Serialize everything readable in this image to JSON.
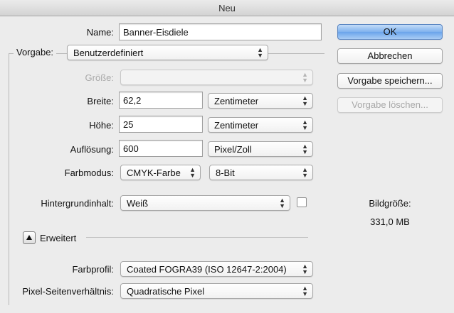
{
  "window": {
    "title": "Neu"
  },
  "form": {
    "name_label": "Name:",
    "name_value": "Banner-Eisdiele",
    "vorgabe_label": "Vorgabe:",
    "vorgabe_value": "Benutzerdefiniert",
    "groesse_label": "Größe:",
    "groesse_value": "",
    "breite_label": "Breite:",
    "breite_value": "62,2",
    "breite_unit": "Zentimeter",
    "hoehe_label": "Höhe:",
    "hoehe_value": "25",
    "hoehe_unit": "Zentimeter",
    "aufloesung_label": "Auflösung:",
    "aufloesung_value": "600",
    "aufloesung_unit": "Pixel/Zoll",
    "farbmodus_label": "Farbmodus:",
    "farbmodus_value": "CMYK-Farbe",
    "farbtiefe_value": "8-Bit",
    "hintergrund_label": "Hintergrundinhalt:",
    "hintergrund_value": "Weiß",
    "erweitert_label": "Erweitert",
    "farbprofil_label": "Farbprofil:",
    "farbprofil_value": "Coated FOGRA39 (ISO 12647-2:2004)",
    "pixel_label": "Pixel-Seitenverhältnis:",
    "pixel_value": "Quadratische Pixel"
  },
  "buttons": {
    "ok": "OK",
    "abbrechen": "Abbrechen",
    "vorgabe_speichern": "Vorgabe speichern...",
    "vorgabe_loeschen": "Vorgabe löschen..."
  },
  "info": {
    "bildgroesse_label": "Bildgröße:",
    "bildgroesse_value": "331,0 MB"
  },
  "colors": {
    "default_button": "#6aa4ea",
    "window_bg": "#ececec"
  }
}
